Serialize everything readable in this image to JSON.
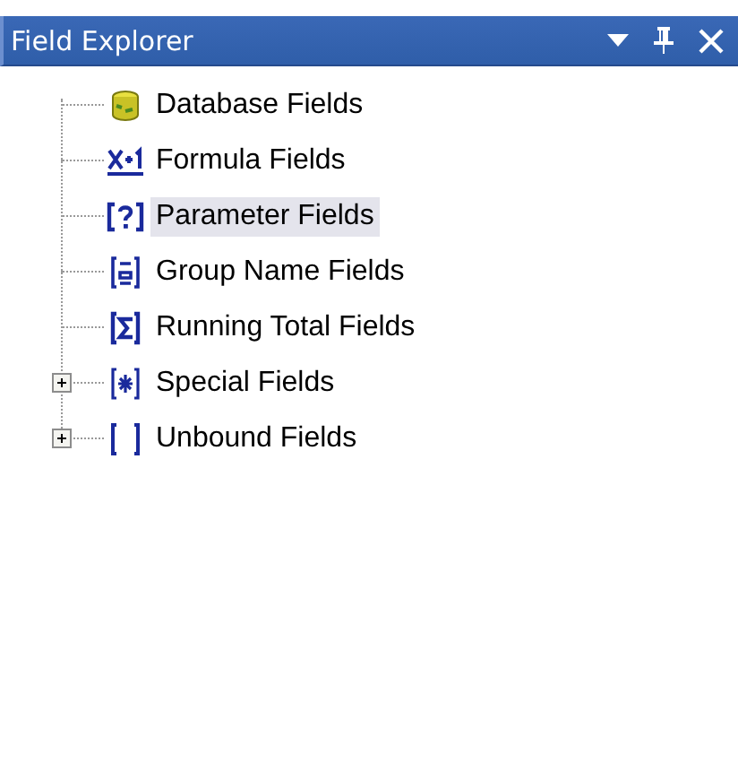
{
  "window": {
    "title": "Field Explorer"
  },
  "tree": {
    "items": [
      {
        "label": "Database Fields",
        "kind": "database",
        "has_children": false,
        "selected": false
      },
      {
        "label": "Formula Fields",
        "kind": "formula",
        "has_children": false,
        "selected": false
      },
      {
        "label": "Parameter Fields",
        "kind": "parameter",
        "has_children": false,
        "selected": true
      },
      {
        "label": "Group Name Fields",
        "kind": "group",
        "has_children": false,
        "selected": false
      },
      {
        "label": "Running Total Fields",
        "kind": "total",
        "has_children": false,
        "selected": false
      },
      {
        "label": "Special Fields",
        "kind": "special",
        "has_children": true,
        "selected": false
      },
      {
        "label": "Unbound Fields",
        "kind": "unbound",
        "has_children": true,
        "selected": false
      }
    ]
  }
}
